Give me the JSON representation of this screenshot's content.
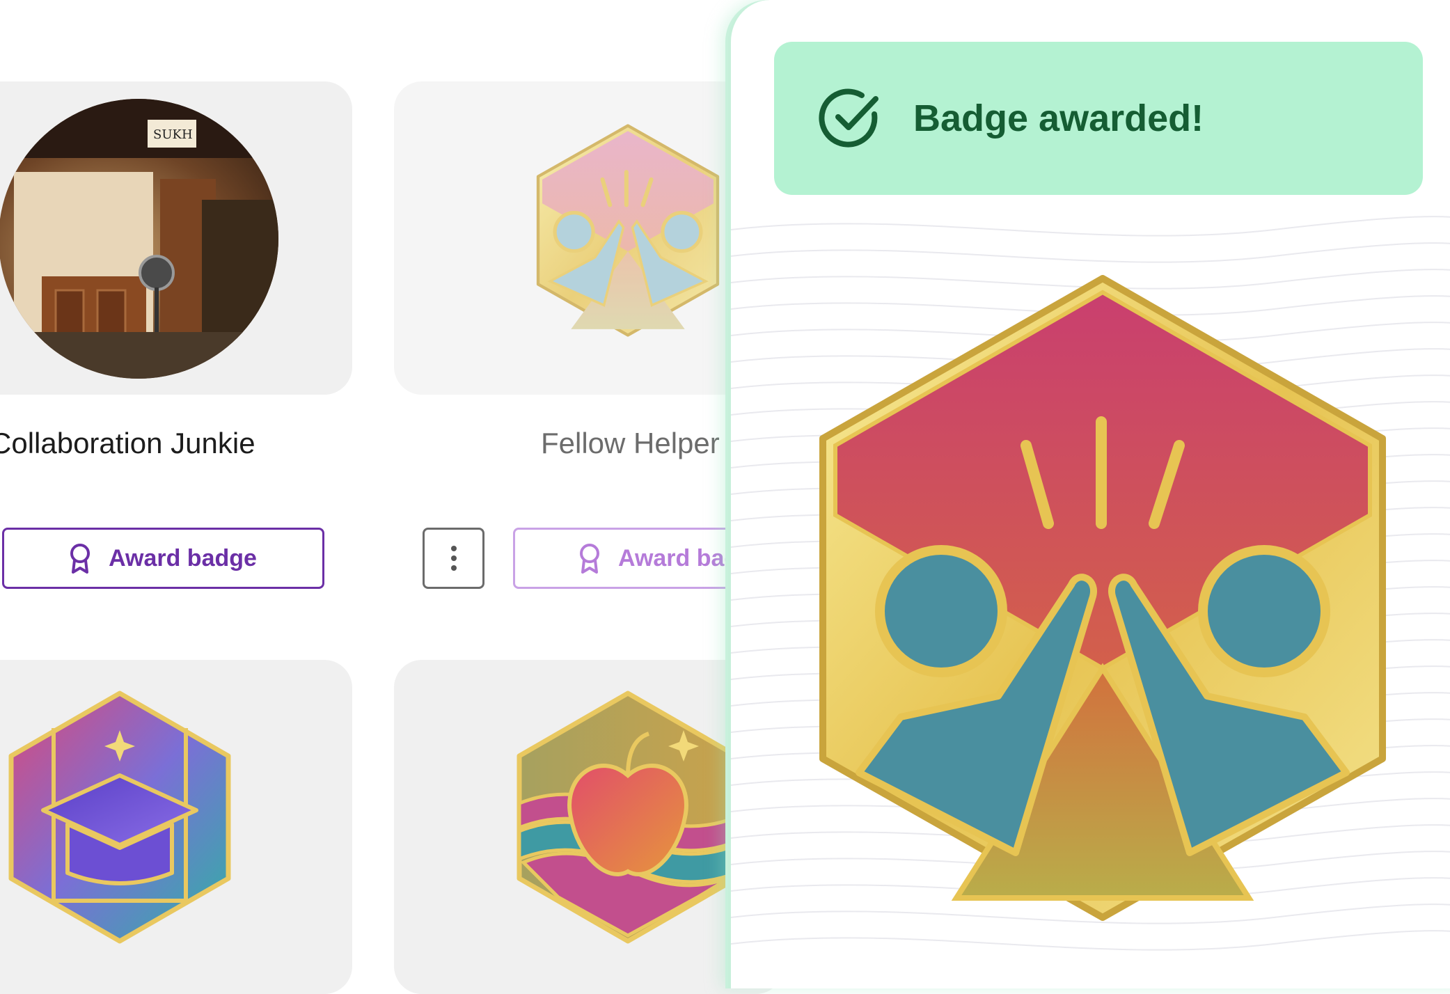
{
  "cards": [
    {
      "title": "Collaboration Junkie",
      "button_label": "Award badge",
      "image": "storefront-photo"
    },
    {
      "title": "Fellow Helper",
      "button_label": "Award badge",
      "image": "high-five-badge"
    },
    {
      "image": "graduation-cap-badge"
    },
    {
      "image": "apple-badge"
    }
  ],
  "toast": {
    "message": "Badge awarded!",
    "icon": "check-circle-icon"
  },
  "awarded_badge": {
    "image": "high-five-badge"
  },
  "colors": {
    "accent_purple": "#6b2fa6",
    "accent_purple_faded": "#c9a2e6",
    "toast_bg": "#b4f2d2",
    "toast_text": "#155d33",
    "card_bg": "#f0f0f0"
  }
}
